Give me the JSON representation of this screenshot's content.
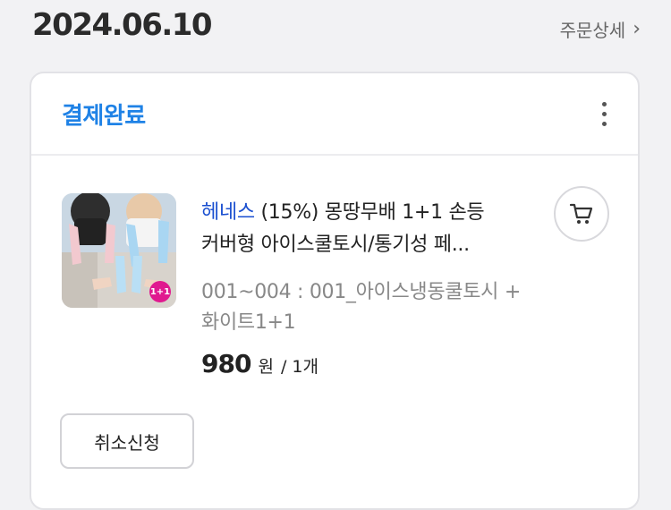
{
  "order": {
    "date": "2024.06.10",
    "detail_link": "주문상세",
    "status": "결제완료"
  },
  "item": {
    "brand": "헤네스",
    "title_line1_rest": " (15%) 몽땅무배 1+1 손등",
    "title_line2": "커버형 아이스쿨토시/통기성 페...",
    "option": "001~004 : 001_아이스냉동쿨토시 + 화이트1+1",
    "price": "980",
    "currency": "원",
    "quantity": "/ 1개",
    "badge": "1+1"
  },
  "actions": {
    "cancel_label": "취소신청"
  },
  "icons": {
    "more": "more-vertical-icon",
    "cart": "cart-icon",
    "detail": "chevron-right-icon"
  },
  "colors": {
    "status": "#1f82e6",
    "brand": "#1a4fd0",
    "badge": "#e0198f"
  }
}
